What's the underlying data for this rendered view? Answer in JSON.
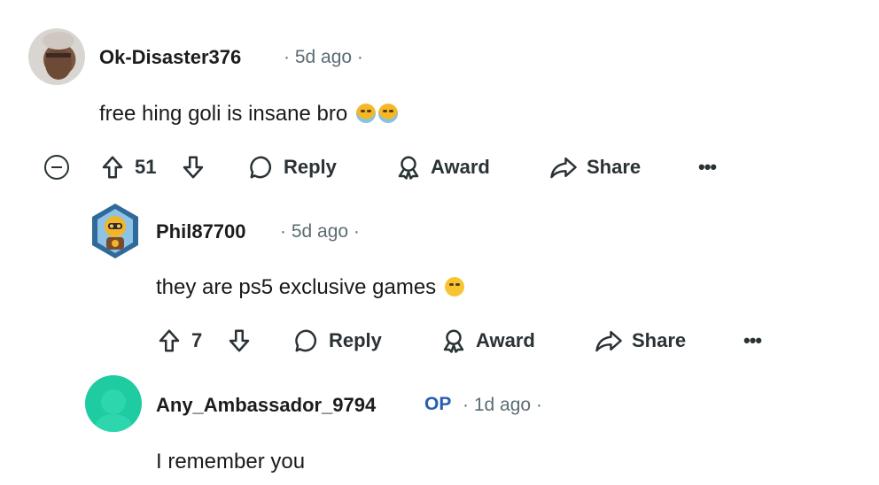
{
  "comments": [
    {
      "author": "Ok-Disaster376",
      "time": "5d ago",
      "text": "free hing goli is insane bro",
      "emoji": "loudly-crying-emoji x2",
      "votes": "51",
      "actions": {
        "reply": "Reply",
        "award": "Award",
        "share": "Share",
        "more": "•••"
      }
    },
    {
      "author": "Phil87700",
      "time": "5d ago",
      "text": "they are ps5 exclusive games",
      "emoji": "grinning-sweat-emoji",
      "votes": "7",
      "actions": {
        "reply": "Reply",
        "award": "Award",
        "share": "Share",
        "more": "•••"
      }
    },
    {
      "author": "Any_Ambassador_9794",
      "op_badge": "OP",
      "time": "1d ago",
      "text": "I remember you"
    }
  ],
  "colors": {
    "op": "#2a5db0",
    "meta": "#5c6c74",
    "text": "#1a1a1b"
  }
}
